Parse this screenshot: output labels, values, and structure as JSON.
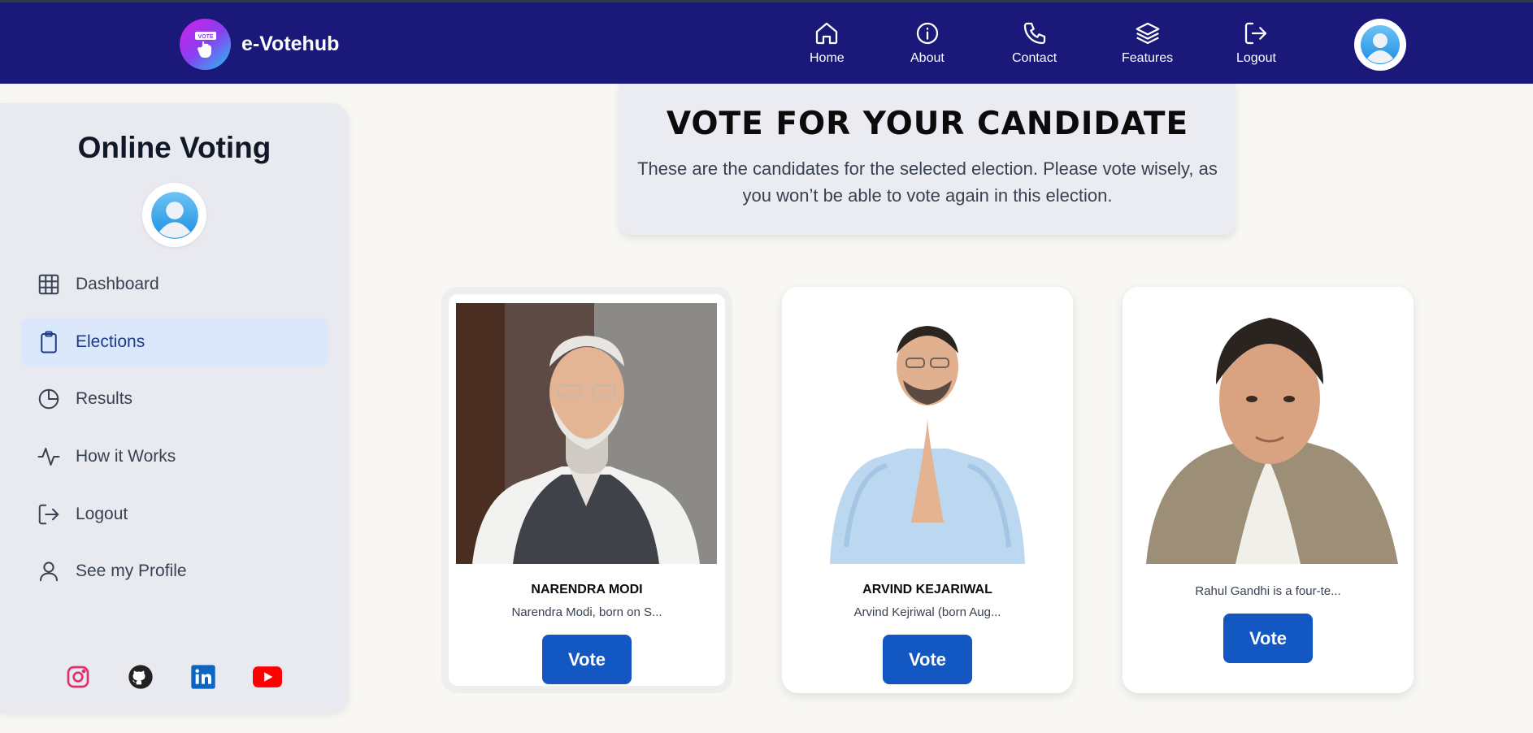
{
  "brand": {
    "name": "e-Votehub",
    "logo_text": "VOTE"
  },
  "nav": {
    "items": [
      {
        "label": "Home",
        "icon": "home-icon"
      },
      {
        "label": "About",
        "icon": "info-icon"
      },
      {
        "label": "Contact",
        "icon": "phone-icon"
      },
      {
        "label": "Features",
        "icon": "layers-icon"
      },
      {
        "label": "Logout",
        "icon": "logout-icon"
      }
    ]
  },
  "sidebar": {
    "title": "Online Voting",
    "items": [
      {
        "label": "Dashboard",
        "icon": "grid-icon"
      },
      {
        "label": "Elections",
        "icon": "clipboard-icon",
        "active": true
      },
      {
        "label": "Results",
        "icon": "pie-chart-icon"
      },
      {
        "label": "How it Works",
        "icon": "activity-icon"
      },
      {
        "label": "Logout",
        "icon": "logout-icon"
      },
      {
        "label": "See my Profile",
        "icon": "user-icon"
      }
    ],
    "socials": [
      "instagram-icon",
      "github-icon",
      "linkedin-icon",
      "youtube-icon"
    ]
  },
  "hero": {
    "title": "VOTE FOR YOUR CANDIDATE",
    "text": "These are the candidates for the selected election. Please vote wisely, as you won’t be able to vote again in this election."
  },
  "candidates": [
    {
      "name": "NARENDRA MODI",
      "desc": "Narendra Modi, born on S...",
      "vote_label": "Vote",
      "selected": true
    },
    {
      "name": "ARVIND KEJARIWAL",
      "desc": "Arvind Kejriwal (born Aug...",
      "vote_label": "Vote"
    },
    {
      "name": "",
      "desc": "Rahul Gandhi is a four-te...",
      "vote_label": "Vote"
    }
  ],
  "colors": {
    "topbar": "#1a197a",
    "vote_button": "#1257c2",
    "active_menu_bg": "#dbe7fb",
    "page_bg": "#f8f7f3"
  }
}
